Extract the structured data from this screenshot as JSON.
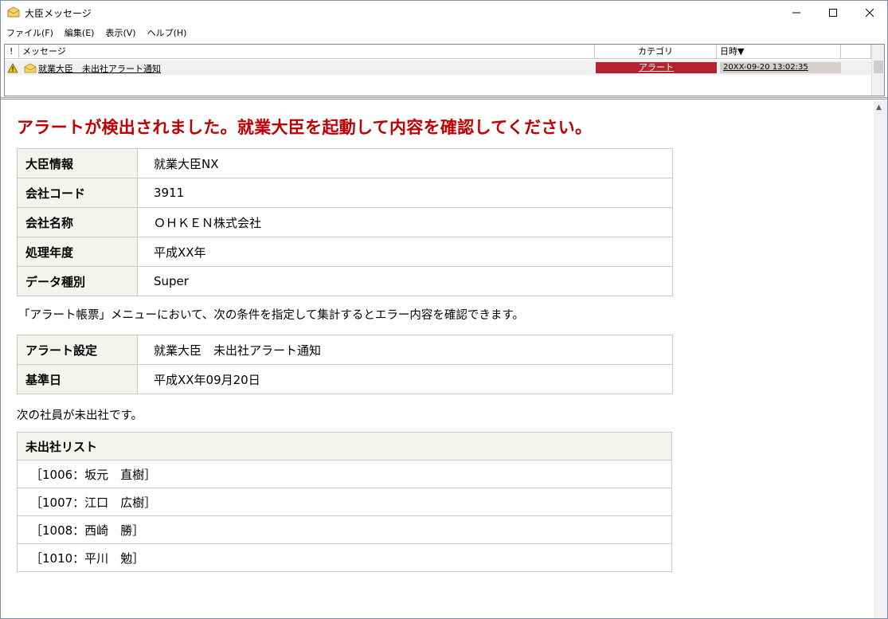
{
  "window": {
    "title": "大臣メッセージ",
    "icon": "envelope-icon"
  },
  "menu": {
    "items": [
      "ファイル(F)",
      "編集(E)",
      "表示(V)",
      "ヘルプ(H)"
    ]
  },
  "list": {
    "headers": {
      "flag": "!",
      "message": "メッセージ",
      "category": "カテゴリ",
      "date": "日時▼"
    },
    "rows": [
      {
        "message": "就業大臣　未出社アラート通知",
        "category": "アラート",
        "date": "20XX-09-20 13:02:35",
        "flag_icon": "warning-icon",
        "status_icon": "open-envelope-icon"
      }
    ]
  },
  "colors": {
    "headline": "#c00000",
    "category_alert": "#b5232e",
    "label_bg": "#f5f3ee"
  },
  "detail": {
    "headline": "アラートが検出されました。就業大臣を起動して内容を確認してください。",
    "info": [
      {
        "label": "大臣情報",
        "value": "就業大臣NX"
      },
      {
        "label": "会社コード",
        "value": "3911"
      },
      {
        "label": "会社名称",
        "value": "ＯＨＫＥＮ株式会社"
      },
      {
        "label": "処理年度",
        "value": "平成XX年"
      },
      {
        "label": "データ種別",
        "value": "Super"
      }
    ],
    "note1": "「アラート帳票」メニューにおいて、次の条件を指定して集計するとエラー内容を確認できます。",
    "conditions": [
      {
        "label": "アラート設定",
        "value": "就業大臣　未出社アラート通知"
      },
      {
        "label": "基準日",
        "value": "平成XX年09月20日"
      }
    ],
    "note2": "次の社員が未出社です。",
    "absent": {
      "header": "未出社リスト",
      "items": [
        "［1006：坂元　直樹］",
        "［1007：江口　広樹］",
        "［1008：西崎　勝］",
        "［1010：平川　勉］"
      ]
    }
  }
}
